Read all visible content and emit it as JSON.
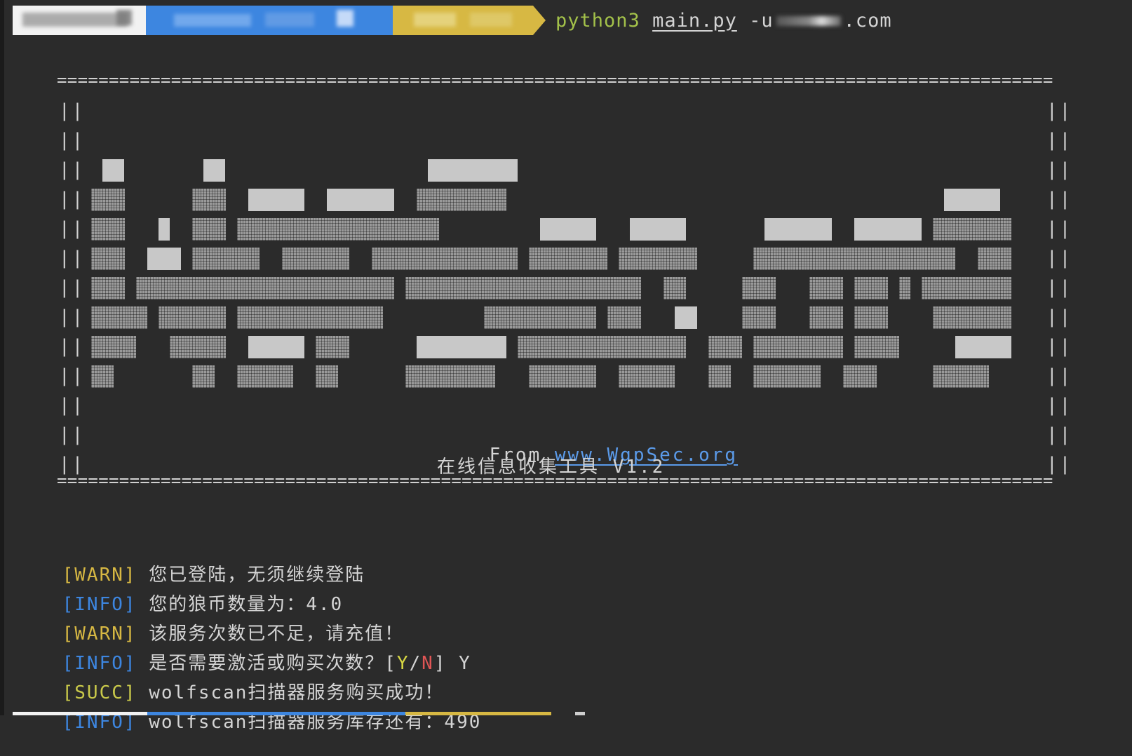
{
  "prompt": {
    "command": "python3",
    "file": "main.py",
    "flag": "-u",
    "domain_suffix": ".com"
  },
  "banner": {
    "rule": "================================================================================================",
    "pipe": "||",
    "from_label": "From",
    "from_link": "www.WgpSec.org",
    "subtitle": "在线信息收集工具 V1.2"
  },
  "log": [
    {
      "tag": "[WARN]",
      "level": "warn",
      "text": "您已登陆，无须继续登陆"
    },
    {
      "tag": "[INFO]",
      "level": "info",
      "text": "您的狼币数量为：4.0"
    },
    {
      "tag": "[WARN]",
      "level": "warn",
      "text": "该服务次数已不足，请充值！"
    },
    {
      "tag": "[INFO]",
      "level": "info",
      "text_before": "是否需要激活或购买次数？[",
      "yes": "Y",
      "slash": "/",
      "no": "N",
      "text_after": "] Y"
    },
    {
      "tag": "[SUCC]",
      "level": "succ",
      "text": "wolfscan扫描器服务购买成功！"
    },
    {
      "tag": "[INFO]",
      "level": "info",
      "text": "wolfscan扫描器服务库存还有：490"
    }
  ],
  "colors": {
    "background": "#2b2b2b",
    "warn": "#d7b843",
    "info": "#3d86e0",
    "succ": "#c9c94a",
    "link": "#5b9bea",
    "python": "#a3c14a",
    "no": "#e05555"
  }
}
